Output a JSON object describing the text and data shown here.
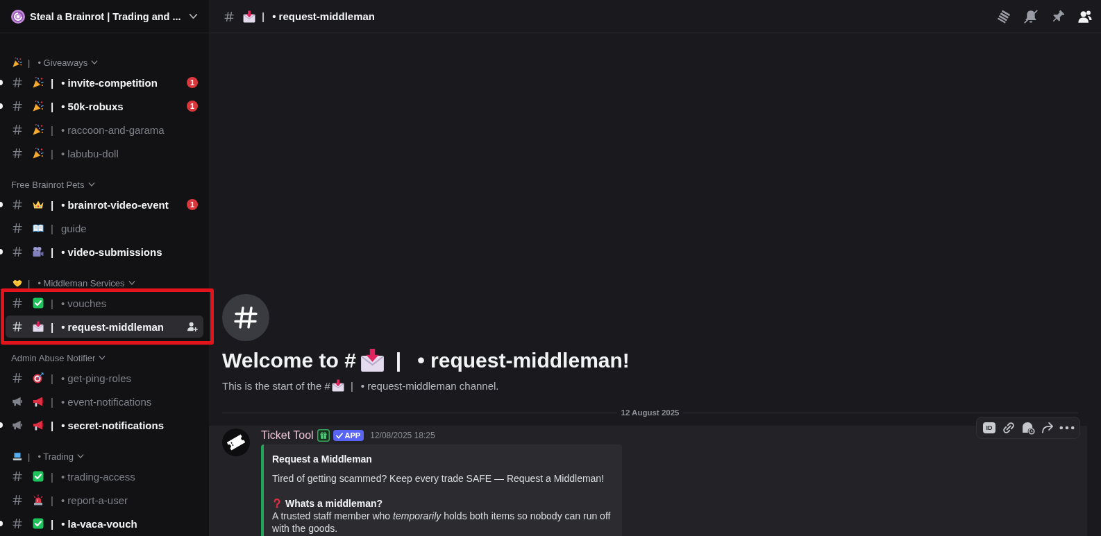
{
  "server": {
    "name": "Steal a Brainrot | Trading and ..."
  },
  "categories": [
    {
      "emoji": {
        "kind": "party"
      },
      "bar": "|",
      "name": "• Giveaways",
      "outlined": false,
      "channels": [
        {
          "kind": "text",
          "emoji": {
            "kind": "party"
          },
          "bar": "|",
          "name": "• invite-competition",
          "unread": true,
          "selected": false,
          "mentions": "1"
        },
        {
          "kind": "text",
          "emoji": {
            "kind": "party"
          },
          "bar": "|",
          "name": "• 50k-robuxs",
          "unread": true,
          "selected": false,
          "mentions": "1"
        },
        {
          "kind": "text",
          "emoji": {
            "kind": "party"
          },
          "bar": "|",
          "name": "• raccoon-and-garama",
          "unread": false,
          "selected": false
        },
        {
          "kind": "text",
          "emoji": {
            "kind": "party"
          },
          "bar": "|",
          "name": "• labubu-doll",
          "unread": false,
          "selected": false
        }
      ]
    },
    {
      "name": "Free Brainrot Pets",
      "outlined": false,
      "channels": [
        {
          "kind": "text",
          "emoji": {
            "kind": "crown"
          },
          "bar": "|",
          "name": "• brainrot-video-event",
          "unread": true,
          "selected": false,
          "mentions": "1"
        },
        {
          "kind": "text",
          "emoji": {
            "kind": "book"
          },
          "bar": "|",
          "name": "guide",
          "unread": false,
          "selected": false
        },
        {
          "kind": "text",
          "emoji": {
            "kind": "camera"
          },
          "bar": "|",
          "name": "• video-submissions",
          "unread": true,
          "selected": false
        }
      ]
    },
    {
      "emoji": {
        "kind": "handshake"
      },
      "bar": "|",
      "name": "• Middleman Services",
      "outlined": true,
      "channels": [
        {
          "kind": "text",
          "emoji": {
            "kind": "check"
          },
          "bar": "|",
          "name": "• vouches",
          "unread": false,
          "selected": false
        },
        {
          "kind": "text",
          "emoji": {
            "kind": "envelope"
          },
          "bar": "|",
          "name": "• request-middleman",
          "unread": false,
          "selected": true
        }
      ]
    },
    {
      "name": "Admin Abuse Notifier",
      "outlined": false,
      "channels": [
        {
          "kind": "text",
          "emoji": {
            "kind": "target"
          },
          "bar": "|",
          "name": "• get-ping-roles",
          "unread": false,
          "selected": false
        },
        {
          "kind": "announcement",
          "emoji": {
            "kind": "megaphone"
          },
          "bar": "|",
          "name": "• event-notifications",
          "unread": false,
          "selected": false
        },
        {
          "kind": "announcement",
          "emoji": {
            "kind": "megaphone"
          },
          "bar": "|",
          "name": "• secret-notifications",
          "unread": true,
          "selected": false
        }
      ]
    },
    {
      "emoji": {
        "kind": "laptop"
      },
      "bar": "|",
      "name": "• Trading",
      "outlined": false,
      "channels": [
        {
          "kind": "text",
          "emoji": {
            "kind": "check"
          },
          "bar": "|",
          "name": "• trading-access",
          "unread": false,
          "selected": false
        },
        {
          "kind": "text",
          "emoji": {
            "kind": "siren"
          },
          "bar": "|",
          "name": "• report-a-user",
          "unread": false,
          "selected": false
        },
        {
          "kind": "text",
          "emoji": {
            "kind": "check"
          },
          "bar": "|",
          "name": "• la-vaca-vouch",
          "unread": true,
          "selected": false
        }
      ]
    }
  ],
  "header": {
    "channel": {
      "emoji": {
        "kind": "envelope"
      },
      "bar": "|",
      "name": "• request-middleman"
    },
    "tools": [
      {
        "kind": "threads",
        "on": false
      },
      {
        "kind": "mute",
        "on": false
      },
      {
        "kind": "pins",
        "on": false
      },
      {
        "kind": "members",
        "on": true
      }
    ]
  },
  "welcome": {
    "title": "Welcome to #",
    "emoji": {
      "kind": "envelope"
    },
    "bar": "|",
    "channel": "• request-middleman!",
    "intro": "This is the start of the #",
    "intro_emoji": {
      "kind": "envelope"
    },
    "intro_bar": "|",
    "intro_end": "• request-middleman channel."
  },
  "divider": {
    "date": "12 August 2025"
  },
  "message": {
    "hovered": true,
    "author": "Ticket Tool",
    "badge": "APP",
    "time": "12/08/2025 18:25",
    "actions": [
      {
        "kind": "id",
        "label": "ID"
      },
      {
        "kind": "link"
      },
      {
        "kind": "app"
      },
      {
        "kind": "forward"
      },
      {
        "kind": "more"
      }
    ],
    "embed": {
      "title": "Request a Middleman",
      "description": "Tired of getting scammed? Keep every trade SAFE — Request a Middleman!",
      "sections": [
        {
          "emoji": {
            "kind": "question"
          },
          "heading": "Whats a middleman?",
          "text": "A trusted staff member who *temporarily* holds both items so nobody can run off with the goods."
        }
      ]
    }
  }
}
